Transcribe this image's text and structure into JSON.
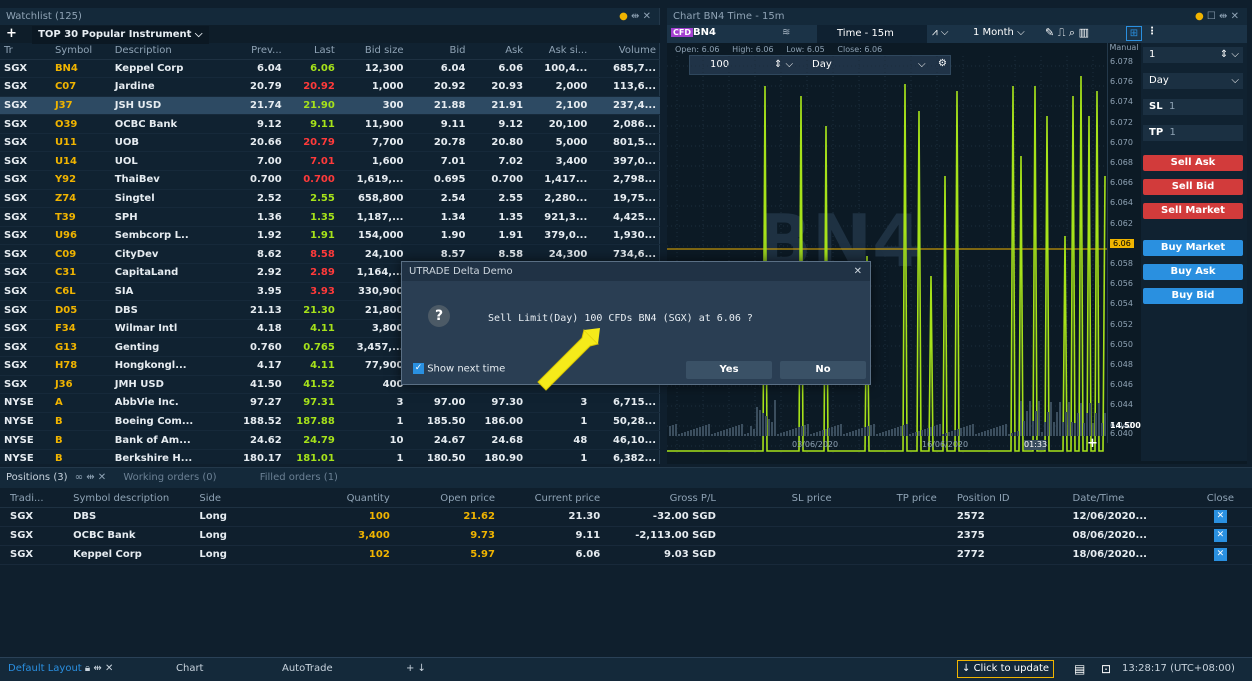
{
  "watchlist": {
    "title": "Watchlist (125)",
    "list_name": "TOP 30 Popular Instrument",
    "columns": [
      "Tr",
      "Symbol",
      "Description",
      "Prev...",
      "Last",
      "Bid size",
      "Bid",
      "Ask",
      "Ask si...",
      "Volume"
    ],
    "rows": [
      [
        "SGX",
        "BN4",
        "Keppel Corp",
        "6.04",
        "6.06",
        "12,300",
        "6.04",
        "6.06",
        "100,4...",
        "685,7...",
        "up"
      ],
      [
        "SGX",
        "C07",
        "Jardine",
        "20.79",
        "20.92",
        "1,000",
        "20.92",
        "20.93",
        "2,000",
        "113,6...",
        "dn"
      ],
      [
        "SGX",
        "J37",
        "JSH USD",
        "21.74",
        "21.90",
        "300",
        "21.88",
        "21.91",
        "2,100",
        "237,4...",
        "up"
      ],
      [
        "SGX",
        "O39",
        "OCBC Bank",
        "9.12",
        "9.11",
        "11,900",
        "9.11",
        "9.12",
        "20,100",
        "2,086...",
        "up"
      ],
      [
        "SGX",
        "U11",
        "UOB",
        "20.66",
        "20.79",
        "7,700",
        "20.78",
        "20.80",
        "5,000",
        "801,5...",
        "dn"
      ],
      [
        "SGX",
        "U14",
        "UOL",
        "7.00",
        "7.01",
        "1,600",
        "7.01",
        "7.02",
        "3,400",
        "397,0...",
        "dn"
      ],
      [
        "SGX",
        "Y92",
        "ThaiBev",
        "0.700",
        "0.700",
        "1,619,...",
        "0.695",
        "0.700",
        "1,417...",
        "2,798...",
        "dn"
      ],
      [
        "SGX",
        "Z74",
        "Singtel",
        "2.52",
        "2.55",
        "658,800",
        "2.54",
        "2.55",
        "2,280...",
        "19,75...",
        "up"
      ],
      [
        "SGX",
        "T39",
        "SPH",
        "1.36",
        "1.35",
        "1,187,...",
        "1.34",
        "1.35",
        "921,3...",
        "4,425...",
        "up"
      ],
      [
        "SGX",
        "U96",
        "Sembcorp L..",
        "1.92",
        "1.91",
        "154,000",
        "1.90",
        "1.91",
        "379,0...",
        "1,930...",
        "up"
      ],
      [
        "SGX",
        "C09",
        "CityDev",
        "8.62",
        "8.58",
        "24,100",
        "8.57",
        "8.58",
        "24,300",
        "734,6...",
        "dn"
      ],
      [
        "SGX",
        "C31",
        "CapitaLand",
        "2.92",
        "2.89",
        "1,164,...",
        "",
        "",
        "",
        "",
        "dn"
      ],
      [
        "SGX",
        "C6L",
        "SIA",
        "3.95",
        "3.93",
        "330,900",
        "",
        "",
        "",
        "",
        "dn"
      ],
      [
        "SGX",
        "D05",
        "DBS",
        "21.13",
        "21.30",
        "21,800",
        "",
        "",
        "",
        "",
        "up"
      ],
      [
        "SGX",
        "F34",
        "Wilmar Intl",
        "4.18",
        "4.11",
        "3,800",
        "",
        "",
        "",
        "",
        "up"
      ],
      [
        "SGX",
        "G13",
        "Genting",
        "0.760",
        "0.765",
        "3,457,...",
        "",
        "",
        "",
        "",
        "up"
      ],
      [
        "SGX",
        "H78",
        "Hongkongl...",
        "4.17",
        "4.11",
        "77,900",
        "",
        "",
        "",
        "",
        "up"
      ],
      [
        "SGX",
        "J36",
        "JMH USD",
        "41.50",
        "41.52",
        "400",
        "",
        "",
        "",
        "",
        "up"
      ],
      [
        "NYSE",
        "A",
        "AbbVie Inc.",
        "97.27",
        "97.31",
        "3",
        "97.00",
        "97.30",
        "3",
        "6,715...",
        "up"
      ],
      [
        "NYSE",
        "B",
        "Boeing Com...",
        "188.52",
        "187.88",
        "1",
        "185.50",
        "186.00",
        "1",
        "50,28...",
        "up"
      ],
      [
        "NYSE",
        "B",
        "Bank of Am...",
        "24.62",
        "24.79",
        "10",
        "24.67",
        "24.68",
        "48",
        "46,10...",
        "up"
      ],
      [
        "NYSE",
        "B",
        "Berkshire H...",
        "180.17",
        "181.01",
        "1",
        "180.50",
        "180.90",
        "1",
        "6,382...",
        "up"
      ]
    ]
  },
  "chart": {
    "title": "Chart BN4 Time - 15m",
    "badge": "CFD",
    "symbol": "BN4",
    "timeframe": "Time - 15m",
    "range": "1 Month",
    "open": "Open: 6.06",
    "high": "High: 6.06",
    "low": "Low: 6.05",
    "close": "Close: 6.06",
    "qty": "100",
    "duration": "Day",
    "watermark": "BN4",
    "yticks": [
      "6.078",
      "6.076",
      "6.074",
      "6.072",
      "6.070",
      "6.068",
      "6.066",
      "6.064",
      "6.062",
      "6.06",
      "6.058",
      "6.056",
      "6.054",
      "6.052",
      "6.050",
      "6.048",
      "6.046",
      "6.044",
      "6.042"
    ],
    "vol_label": "14,500",
    "vol_label2": "6.040",
    "xticks": [
      "03/06/2020",
      "16/06/2020"
    ],
    "time_marker": "01:33",
    "manual": "Manual"
  },
  "order_panel": {
    "qty": "1",
    "duration": "Day",
    "sl_label": "SL",
    "sl_val": "1",
    "tp_label": "TP",
    "tp_val": "1",
    "sell_ask": "Sell Ask",
    "sell_bid": "Sell Bid",
    "sell_market": "Sell Market",
    "buy_market": "Buy Market",
    "buy_ask": "Buy Ask",
    "buy_bid": "Buy Bid"
  },
  "dialog": {
    "title": "UTRADE Delta Demo",
    "message": "Sell Limit(Day) 100 CFDs BN4 (SGX) at 6.06 ?",
    "checkbox": "Show next time",
    "yes": "Yes",
    "no": "No"
  },
  "positions": {
    "tab_positions": "Positions (3)",
    "tab_working": "Working orders (0)",
    "tab_filled": "Filled orders (1)",
    "columns": [
      "Tradi...",
      "Symbol description",
      "Side",
      "Quantity",
      "Open price",
      "Current price",
      "Gross P/L",
      "SL price",
      "TP price",
      "Position ID",
      "Date/Time",
      "Close"
    ],
    "rows": [
      [
        "SGX",
        "DBS",
        "Long",
        "100",
        "21.62",
        "21.30",
        "-32.00 SGD",
        "",
        "",
        "2572",
        "12/06/2020..."
      ],
      [
        "SGX",
        "OCBC Bank",
        "Long",
        "3,400",
        "9.73",
        "9.11",
        "-2,113.00 SGD",
        "",
        "",
        "2375",
        "08/06/2020..."
      ],
      [
        "SGX",
        "Keppel Corp",
        "Long",
        "102",
        "5.97",
        "6.06",
        "9.03 SGD",
        "",
        "",
        "2772",
        "18/06/2020..."
      ]
    ]
  },
  "bottom": {
    "layout": "Default Layout",
    "tab_chart": "Chart",
    "tab_autotrade": "AutoTrade",
    "update": "Click to update",
    "clock": "13:28:17 (UTC+08:00)"
  }
}
